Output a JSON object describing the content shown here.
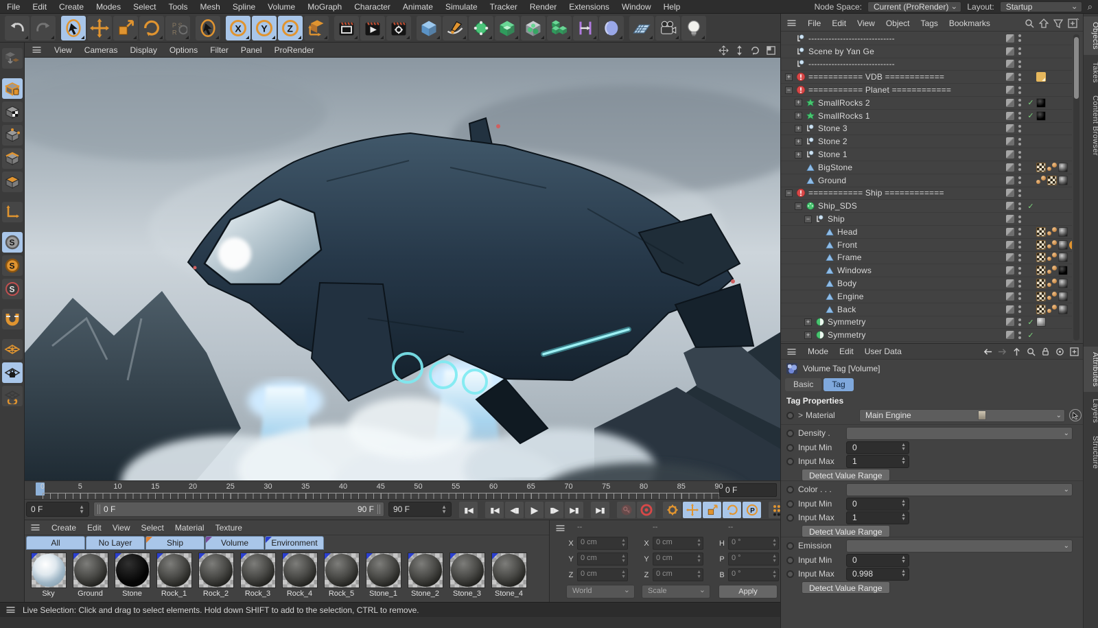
{
  "menu_bar": {
    "items": [
      "File",
      "Edit",
      "Create",
      "Modes",
      "Select",
      "Tools",
      "Mesh",
      "Spline",
      "Volume",
      "MoGraph",
      "Character",
      "Animate",
      "Simulate",
      "Tracker",
      "Render",
      "Extensions",
      "Window",
      "Help"
    ]
  },
  "top_right": {
    "node_space_label": "Node Space:",
    "node_space_value": "Current (ProRender)",
    "layout_label": "Layout:",
    "layout_value": "Startup"
  },
  "toolbar": {
    "icons": [
      {
        "name": "undo",
        "sel": false
      },
      {
        "name": "redo",
        "sel": false
      },
      {
        "name": "sep"
      },
      {
        "name": "live-selection",
        "sel": true
      },
      {
        "name": "move",
        "sel": false
      },
      {
        "name": "scale",
        "sel": false
      },
      {
        "name": "rotate",
        "sel": false
      },
      {
        "name": "psr",
        "sel": false
      },
      {
        "name": "sep"
      },
      {
        "name": "last-tool",
        "sel": false
      },
      {
        "name": "sep"
      },
      {
        "name": "axis-x",
        "sel": true
      },
      {
        "name": "axis-y",
        "sel": true
      },
      {
        "name": "axis-z",
        "sel": true
      },
      {
        "name": "coord-system",
        "sel": false
      },
      {
        "name": "sep"
      },
      {
        "name": "render-view",
        "sel": false
      },
      {
        "name": "render-picture-viewer",
        "sel": false
      },
      {
        "name": "render-settings",
        "sel": false
      },
      {
        "name": "sep"
      },
      {
        "name": "primitive-cube",
        "sel": false
      },
      {
        "name": "spline-pen",
        "sel": false
      },
      {
        "name": "subdivision-surface",
        "sel": false
      },
      {
        "name": "generator",
        "sel": false
      },
      {
        "name": "volume-builder",
        "sel": false
      },
      {
        "name": "volume-mesher",
        "sel": false
      },
      {
        "name": "mograph",
        "sel": false
      },
      {
        "name": "field",
        "sel": false
      },
      {
        "name": "sep"
      },
      {
        "name": "floor",
        "sel": false
      },
      {
        "name": "camera",
        "sel": false
      },
      {
        "name": "light",
        "sel": false
      }
    ]
  },
  "left_tools": [
    {
      "name": "make-editable",
      "sel": false
    },
    {
      "name": "gap"
    },
    {
      "name": "model-mode",
      "sel": true
    },
    {
      "name": "texture-mode",
      "sel": false
    },
    {
      "name": "point-mode",
      "sel": false
    },
    {
      "name": "edge-mode",
      "sel": false
    },
    {
      "name": "polygon-mode",
      "sel": false
    },
    {
      "name": "gap"
    },
    {
      "name": "axis-mode",
      "sel": false
    },
    {
      "name": "gap"
    },
    {
      "name": "snap-enable",
      "sel": true
    },
    {
      "name": "snap-modes",
      "sel": false
    },
    {
      "name": "snap-settings",
      "sel": false
    },
    {
      "name": "gap"
    },
    {
      "name": "magnet-snap",
      "sel": false
    },
    {
      "name": "gap"
    },
    {
      "name": "workplane",
      "sel": false
    },
    {
      "name": "lock-workplane",
      "sel": true
    },
    {
      "name": "workplane-rotate",
      "sel": false
    }
  ],
  "viewport": {
    "menus": [
      "View",
      "Cameras",
      "Display",
      "Options",
      "Filter",
      "Panel",
      "ProRender"
    ]
  },
  "object_manager": {
    "menus": [
      "File",
      "Edit",
      "View",
      "Object",
      "Tags",
      "Bookmarks"
    ],
    "rows": [
      {
        "indent": 0,
        "icon": "null",
        "label": "------------------------------"
      },
      {
        "indent": 0,
        "icon": "null",
        "label": "Scene by Yan Ge"
      },
      {
        "indent": 0,
        "icon": "null",
        "label": "------------------------------"
      },
      {
        "indent": 0,
        "exp": "plus",
        "icon": "alert",
        "label": "=========== VDB ============",
        "chips": [
          "note"
        ]
      },
      {
        "indent": 0,
        "exp": "minus",
        "icon": "alert",
        "label": "=========== Planet ============"
      },
      {
        "indent": 1,
        "exp": "plus",
        "icon": "matrix",
        "label": "SmallRocks 2",
        "check": true,
        "chips": [
          "sphere-black"
        ]
      },
      {
        "indent": 1,
        "exp": "plus",
        "icon": "matrix",
        "label": "SmallRocks 1",
        "check": true,
        "chips": [
          "sphere-black"
        ]
      },
      {
        "indent": 1,
        "exp": "plus",
        "icon": "null",
        "label": "Stone 3"
      },
      {
        "indent": 1,
        "exp": "plus",
        "icon": "null",
        "label": "Stone 2"
      },
      {
        "indent": 1,
        "exp": "plus",
        "icon": "null",
        "label": "Stone 1"
      },
      {
        "indent": 1,
        "icon": "poly",
        "label": "BigStone",
        "chips": [
          "checker",
          "dots",
          "sphere"
        ]
      },
      {
        "indent": 1,
        "icon": "poly",
        "label": "Ground",
        "chips": [
          "dots",
          "checker",
          "sphere"
        ]
      },
      {
        "indent": 0,
        "exp": "minus",
        "icon": "alert",
        "label": "=========== Ship ============"
      },
      {
        "indent": 1,
        "exp": "minus",
        "icon": "sds",
        "label": "Ship_SDS",
        "check": true
      },
      {
        "indent": 2,
        "exp": "minus",
        "icon": "null",
        "label": "Ship"
      },
      {
        "indent": 3,
        "icon": "poly",
        "label": "Head",
        "chips": [
          "checker",
          "dots",
          "sphere"
        ]
      },
      {
        "indent": 3,
        "icon": "poly",
        "label": "Front",
        "chips": [
          "checker",
          "dots",
          "sphere",
          "gear"
        ]
      },
      {
        "indent": 3,
        "icon": "poly",
        "label": "Frame",
        "chips": [
          "checker",
          "dots",
          "sphere"
        ]
      },
      {
        "indent": 3,
        "icon": "poly",
        "label": "Windows",
        "chips": [
          "checker",
          "dots",
          "sphere-black"
        ]
      },
      {
        "indent": 3,
        "icon": "poly",
        "label": "Body",
        "chips": [
          "checker",
          "dots",
          "sphere"
        ]
      },
      {
        "indent": 3,
        "icon": "poly",
        "label": "Engine",
        "chips": [
          "checker",
          "dots",
          "sphere"
        ]
      },
      {
        "indent": 3,
        "icon": "poly",
        "label": "Back",
        "chips": [
          "checker",
          "dots",
          "sphere"
        ]
      },
      {
        "indent": 2,
        "exp": "plus",
        "icon": "symmetry",
        "label": "Symmetry",
        "check": true,
        "chips": [
          "sphere-gray"
        ]
      },
      {
        "indent": 2,
        "exp": "plus",
        "icon": "symmetry",
        "label": "Symmetry",
        "check": true
      }
    ]
  },
  "right_tabs_top": [
    {
      "label": "Objects",
      "active": true
    },
    {
      "label": "Takes",
      "active": false
    },
    {
      "label": "Content Browser",
      "active": false
    }
  ],
  "right_tabs_bottom": [
    {
      "label": "Attributes",
      "active": true
    },
    {
      "label": "Layers",
      "active": false
    },
    {
      "label": "Structure",
      "active": false
    }
  ],
  "attributes": {
    "menus": [
      "Mode",
      "Edit",
      "User Data"
    ],
    "object_title": "Volume Tag [Volume]",
    "tabs": [
      {
        "label": "Basic",
        "active": false
      },
      {
        "label": "Tag",
        "active": true
      }
    ],
    "section_title": "Tag Properties",
    "material_label": "Material",
    "material_value": "Main Engine",
    "groups": [
      {
        "channel": "Density .",
        "min_label": "Input Min",
        "min": "0",
        "max_label": "Input Max",
        "max": "1",
        "button": "Detect Value Range"
      },
      {
        "channel": "Color . . .",
        "min_label": "Input Min",
        "min": "0",
        "max_label": "Input Max",
        "max": "1",
        "button": "Detect Value Range"
      },
      {
        "channel": "Emission",
        "min_label": "Input Min",
        "min": "0",
        "max_label": "Input Max",
        "max": "0.998",
        "button": "Detect Value Range"
      }
    ]
  },
  "timeline": {
    "major_ticks": [
      0,
      5,
      10,
      15,
      20,
      25,
      30,
      35,
      40,
      45,
      50,
      55,
      60,
      65,
      70,
      75,
      80,
      85,
      90
    ],
    "frame_start": 0,
    "frame_end": 90,
    "current_frame_box": "0 F",
    "start_spinner": "0 F",
    "range_left": "0 F",
    "range_right": "90 F",
    "end_spinner": "90 F"
  },
  "materials": {
    "menus": [
      "Create",
      "Edit",
      "View",
      "Select",
      "Material",
      "Texture"
    ],
    "tabs": [
      {
        "label": "All",
        "corner": ""
      },
      {
        "label": "No Layer",
        "corner": ""
      },
      {
        "label": "Ship",
        "corner": "#e08030"
      },
      {
        "label": "Volume",
        "corner": "#7a4a9a"
      },
      {
        "label": "Environment",
        "corner": "#2a3fd0"
      }
    ],
    "items": [
      {
        "name": "Sky",
        "type": "sky"
      },
      {
        "name": "Ground",
        "type": "rock"
      },
      {
        "name": "Stone",
        "type": "black"
      },
      {
        "name": "Rock_1",
        "type": "rock"
      },
      {
        "name": "Rock_2",
        "type": "rock"
      },
      {
        "name": "Rock_3",
        "type": "rock"
      },
      {
        "name": "Rock_4",
        "type": "rock"
      },
      {
        "name": "Rock_5",
        "type": "rock"
      },
      {
        "name": "Stone_1",
        "type": "rock"
      },
      {
        "name": "Stone_2",
        "type": "rock"
      },
      {
        "name": "Stone_3",
        "type": "rock"
      },
      {
        "name": "Stone_4",
        "type": "rock"
      }
    ]
  },
  "coordinates": {
    "headers": [
      "--",
      "--",
      "--"
    ],
    "position_rows": [
      [
        "X",
        "0 cm"
      ],
      [
        "Y",
        "0 cm"
      ],
      [
        "Z",
        "0 cm"
      ]
    ],
    "size_rows": [
      [
        "X",
        "0 cm"
      ],
      [
        "Y",
        "0 cm"
      ],
      [
        "Z",
        "0 cm"
      ]
    ],
    "rotation_rows": [
      [
        "H",
        "0 °"
      ],
      [
        "P",
        "0 °"
      ],
      [
        "B",
        "0 °"
      ]
    ],
    "dropdown1": "World",
    "dropdown2": "Scale",
    "apply_label": "Apply"
  },
  "status_bar": {
    "text": "Live Selection: Click and drag to select elements. Hold down SHIFT to add to the selection, CTRL to remove."
  },
  "colors": {
    "accent_blue_selected": "#a9c6e9",
    "tab_blue": "#7fa8dc",
    "alert_red": "#d84848",
    "orange": "#e09430",
    "engine_cyan": "#62e3ea"
  }
}
